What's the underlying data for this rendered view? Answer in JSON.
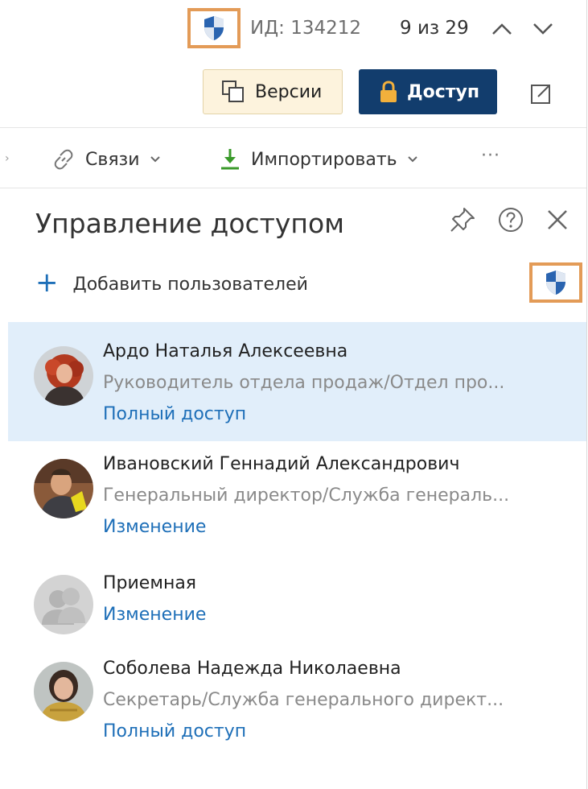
{
  "header": {
    "id_text": "ИД: 134212",
    "counter": "9 из 29"
  },
  "actions": {
    "versions_label": "Версии",
    "access_label": "Доступ"
  },
  "toolbar": {
    "links_label": "Связи",
    "import_label": "Импортировать",
    "more_label": "···"
  },
  "panel": {
    "title": "Управление доступом",
    "add_users_label": "Добавить пользователей",
    "users": [
      {
        "name": "Ардо Наталья Алексеевна",
        "position": "Руководитель отдела продаж/Отдел про...",
        "rights": "Полный доступ",
        "selected": true
      },
      {
        "name": "Ивановский Геннадий Александрович",
        "position": "Генеральный директор/Служба генераль...",
        "rights": "Изменение",
        "selected": false
      },
      {
        "name": "Приемная",
        "position": "",
        "rights": "Изменение",
        "selected": false
      },
      {
        "name": "Соболева Надежда Николаевна",
        "position": "Секретарь/Служба генерального директ...",
        "rights": "Полный доступ",
        "selected": false
      }
    ]
  },
  "icons": {
    "shield": "shield-icon",
    "chevron_up": "chevron-up-icon",
    "chevron_down": "chevron-down-icon",
    "versions": "versions-icon",
    "lock": "lock-icon",
    "open_external": "open-external-icon",
    "link": "link-icon",
    "import": "import-icon",
    "pin": "pin-icon",
    "help": "help-icon",
    "close": "close-icon",
    "plus": "plus-icon"
  },
  "colors": {
    "accent_blue": "#1e6fb8",
    "access_button": "#123d6d",
    "versions_button": "#fdf3dd",
    "highlight_box": "#e39b57",
    "selected_row": "#e1eefa"
  }
}
